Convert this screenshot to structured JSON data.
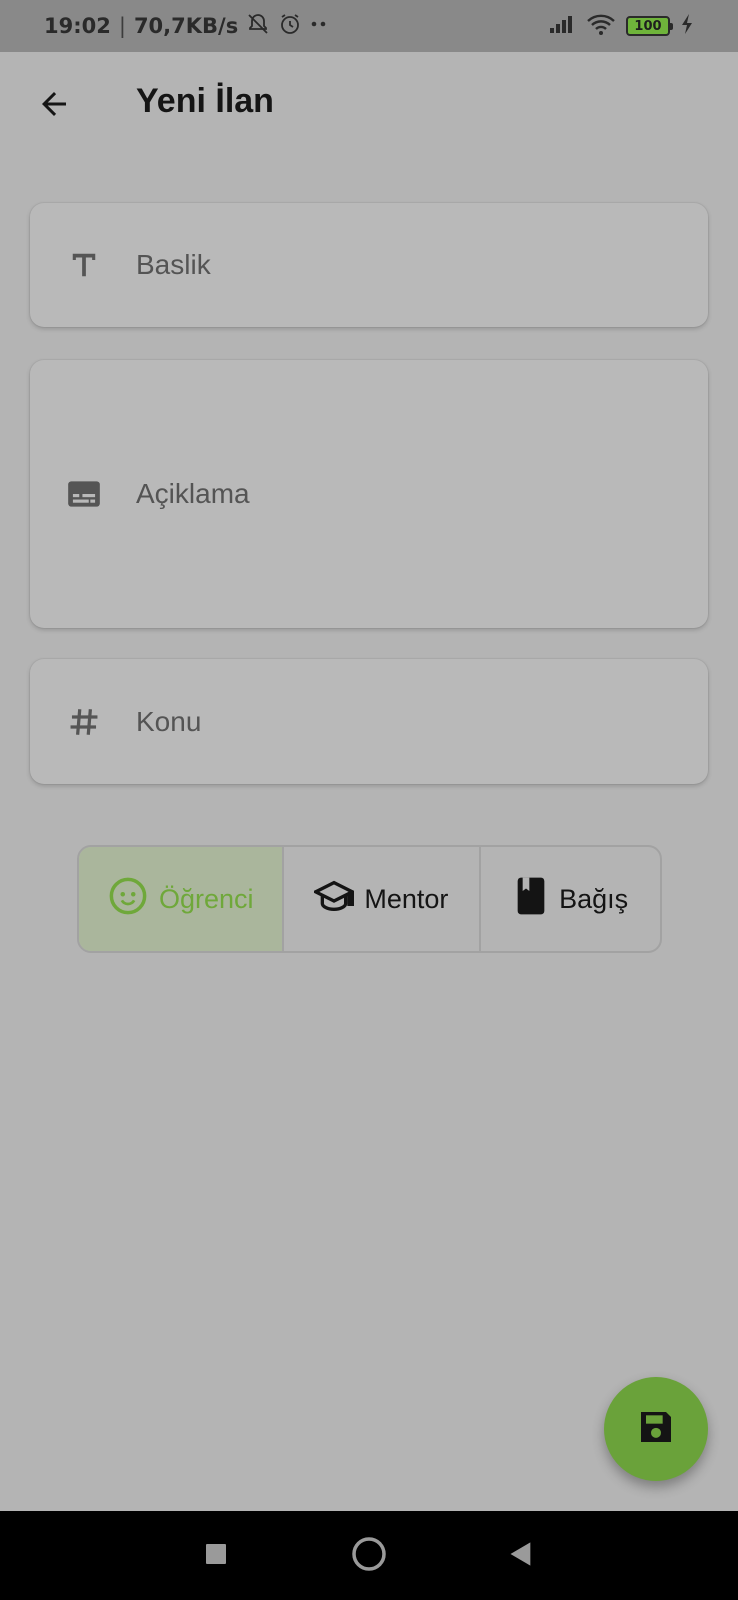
{
  "status_bar": {
    "time": "19:02",
    "separator": "|",
    "network_speed": "70,7KB/s",
    "battery_level": "100"
  },
  "app_bar": {
    "title": "Yeni İlan",
    "back_icon": "arrow-back-icon"
  },
  "form": {
    "title_field": {
      "placeholder": "Baslik",
      "icon": "text-format-icon"
    },
    "description_field": {
      "placeholder": "Açiklama",
      "icon": "subtitles-icon"
    },
    "topic_field": {
      "placeholder": "Konu",
      "icon": "hashtag-icon"
    }
  },
  "segmented": {
    "options": [
      {
        "label": "Öğrenci",
        "icon": "child-face-icon",
        "selected": true
      },
      {
        "label": "Mentor",
        "icon": "school-cap-icon",
        "selected": false
      },
      {
        "label": "Bağış",
        "icon": "book-icon",
        "selected": false
      }
    ]
  },
  "fab": {
    "icon": "save-icon"
  },
  "colors": {
    "accent": "#6fa83a",
    "fab": "#6aa23a",
    "background": "#b4b4b4",
    "selected_segment": "#aab69c"
  }
}
